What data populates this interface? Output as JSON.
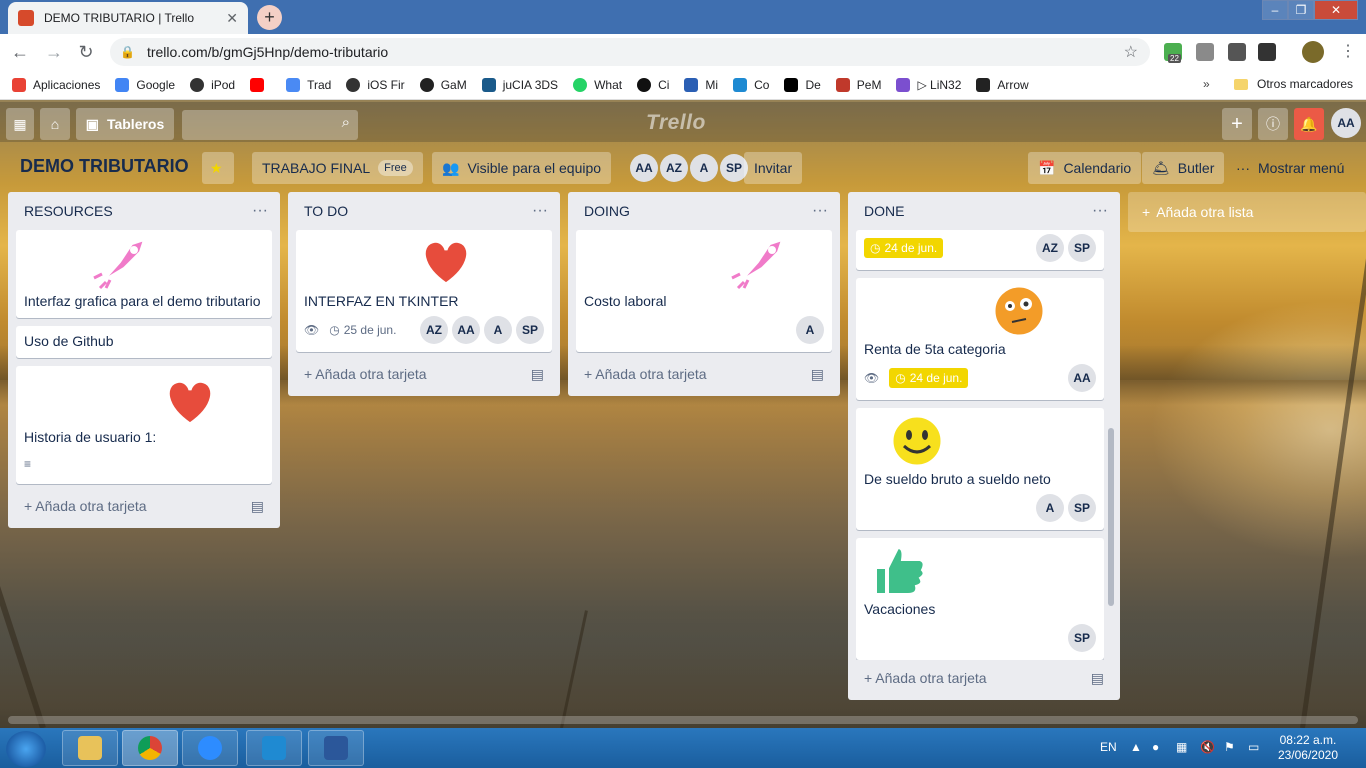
{
  "browser": {
    "tab_title": "DEMO TRIBUTARIO | Trello",
    "url": "trello.com/b/gmGj5Hnp/demo-tributario",
    "ext_badge": "22",
    "bookmarks": [
      {
        "label": "Aplicaciones",
        "color": "#e94235"
      },
      {
        "label": "Google",
        "color": "#4285f4"
      },
      {
        "label": "iPod",
        "color": "#333333"
      },
      {
        "label": "",
        "color": "#ff0000"
      },
      {
        "label": "Trad",
        "color": "#4a8af4"
      },
      {
        "label": "iOS Fir",
        "color": "#333333"
      },
      {
        "label": "GaM",
        "color": "#222222"
      },
      {
        "label": "juCIA 3DS",
        "color": "#1a5a8a"
      },
      {
        "label": "What",
        "color": "#25d366"
      },
      {
        "label": "Ci",
        "color": "#111111"
      },
      {
        "label": "Mi",
        "color": "#2b5fb4"
      },
      {
        "label": "Co",
        "color": "#1e8ad2"
      },
      {
        "label": "De",
        "color": "#000000"
      },
      {
        "label": "PeM",
        "color": "#c0392b"
      },
      {
        "label": "▷ LiN32",
        "color": "#7b4fcf"
      },
      {
        "label": "Arrow",
        "color": "#222222"
      }
    ],
    "more": "»",
    "other_bookmarks": "Otros marcadores"
  },
  "trello_header": {
    "boards_label": "Tableros",
    "logo": "Trello",
    "user_initials": "AA"
  },
  "board": {
    "title": "DEMO TRIBUTARIO",
    "team": "TRABAJO FINAL",
    "team_badge": "Free",
    "visibility": "Visible para el equipo",
    "members": [
      "AA",
      "AZ",
      "A",
      "SP"
    ],
    "invite": "Invitar",
    "calendar": "Calendario",
    "butler": "Butler",
    "show_menu": "Mostrar menú",
    "add_list": "Añada otra lista",
    "add_card": "Añada otra tarjeta"
  },
  "lists": {
    "resources": {
      "title": "RESOURCES",
      "cards": [
        "Interfaz grafica para el demo tributario",
        "Uso de Github",
        "Historia de usuario 1:"
      ]
    },
    "todo": {
      "title": "TO DO",
      "cards": [
        "INTERFAZ EN TKINTER"
      ],
      "due": "25 de jun.",
      "members": [
        "AZ",
        "AA",
        "A",
        "SP"
      ]
    },
    "doing": {
      "title": "DOING",
      "cards": [
        "Costo laboral"
      ],
      "members": [
        "A"
      ]
    },
    "done": {
      "title": "DONE",
      "first_due": "24 de jun.",
      "first_members": [
        "AZ",
        "SP"
      ],
      "cards": [
        "Renta de 5ta categoria",
        "De sueldo bruto a sueldo neto",
        "Vacaciones"
      ],
      "renta_due": "24 de jun.",
      "renta_members": [
        "AA"
      ],
      "sueldo_members": [
        "A",
        "SP"
      ],
      "vac_members": [
        "SP"
      ]
    }
  },
  "taskbar": {
    "lang": "EN",
    "time": "08:22 a.m.",
    "date": "23/06/2020"
  },
  "colors": {
    "due_yellow": "#f2d600",
    "list_bg": "#ebecf0",
    "title_dark": "#172b4d"
  }
}
